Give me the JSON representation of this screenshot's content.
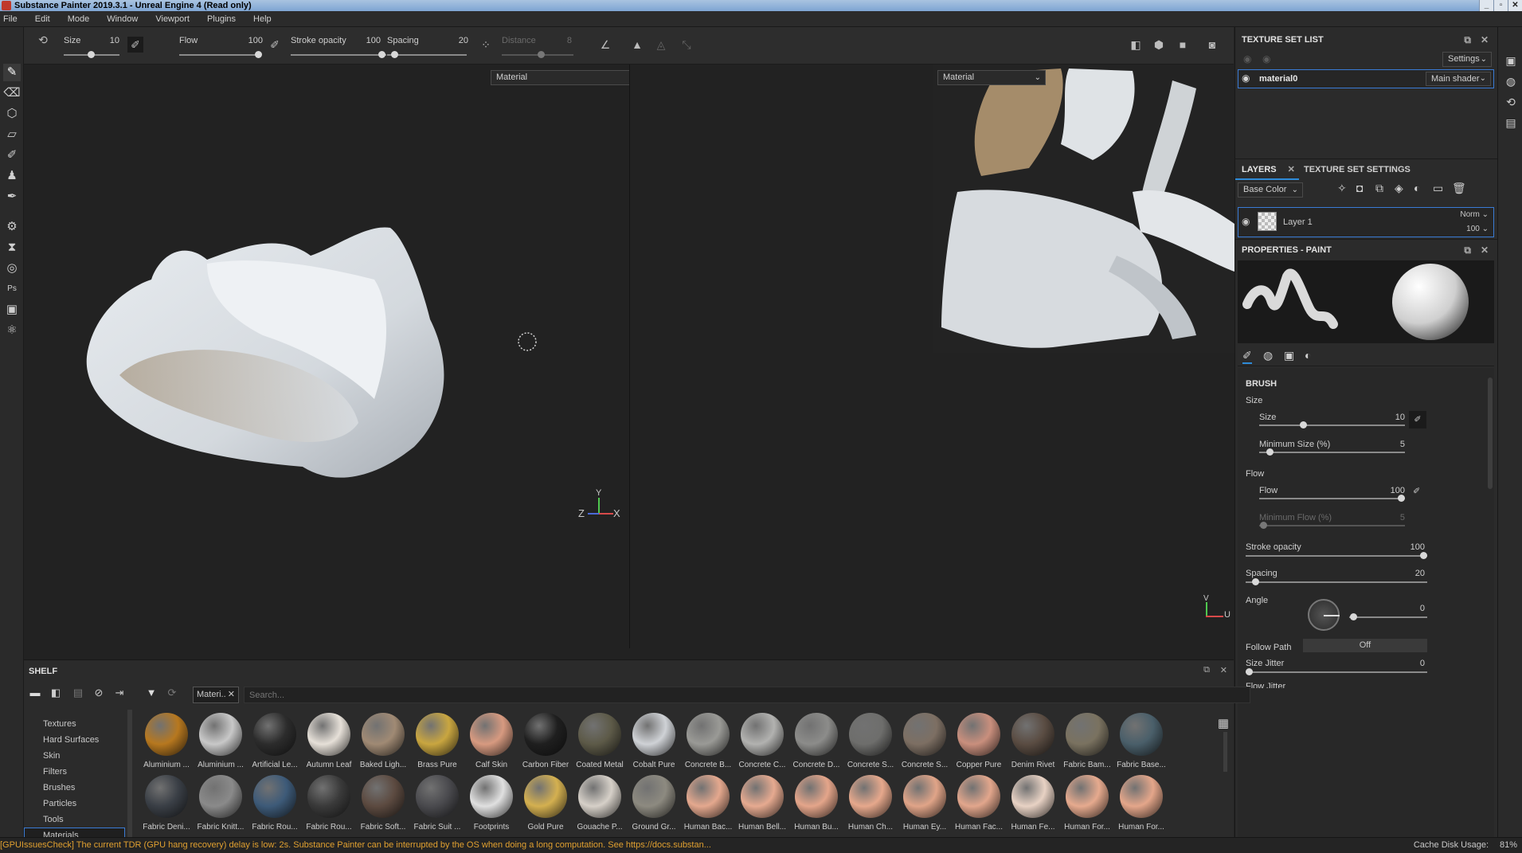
{
  "app": {
    "title": "Substance Painter 2019.3.1 - Unreal Engine 4 (Read only)",
    "window_buttons": [
      "_",
      "▫",
      "✕"
    ]
  },
  "menu": [
    "File",
    "Edit",
    "Mode",
    "Window",
    "Viewport",
    "Plugins",
    "Help"
  ],
  "toolbar": {
    "size_label": "Size",
    "size_value": "10",
    "flow_label": "Flow",
    "flow_value": "100",
    "stroke_opacity_label": "Stroke opacity",
    "stroke_opacity_value": "100",
    "spacing_label": "Spacing",
    "spacing_value": "20",
    "distance_label": "Distance",
    "distance_value": "8"
  },
  "viewport3d": {
    "material_dropdown": "Material",
    "axis": {
      "y": "Y",
      "z": "Z",
      "x": "X"
    }
  },
  "viewport2d": {
    "material_dropdown": "Material",
    "axis": {
      "v": "V",
      "u": "U"
    }
  },
  "texture_set_list": {
    "title": "TEXTURE SET LIST",
    "settings_label": "Settings",
    "item_name": "material0",
    "shader_label": "Main shader"
  },
  "layers_panel": {
    "tab_layers": "LAYERS",
    "tab_texture_set_settings": "TEXTURE SET SETTINGS",
    "channel_dropdown": "Base Color",
    "layer_name": "Layer 1",
    "blend_mode": "Norm",
    "opacity": "100"
  },
  "properties": {
    "title": "PROPERTIES - PAINT",
    "brush_title": "BRUSH",
    "size_group": "Size",
    "size_label": "Size",
    "size_value": "10",
    "size_fraction": 0.3,
    "min_size_label": "Minimum Size (%)",
    "min_size_value": "5",
    "min_size_fraction": 0.05,
    "flow_group": "Flow",
    "flow_label": "Flow",
    "flow_value": "100",
    "flow_fraction": 1.0,
    "min_flow_label": "Minimum Flow (%)",
    "min_flow_value": "5",
    "stroke_opacity_label": "Stroke opacity",
    "stroke_opacity_value": "100",
    "stroke_opacity_fraction": 1.0,
    "spacing_label": "Spacing",
    "spacing_value": "20",
    "spacing_fraction": 0.05,
    "angle_label": "Angle",
    "angle_value": "0",
    "follow_path_label": "Follow Path",
    "follow_path_value": "Off",
    "size_jitter_label": "Size Jitter",
    "size_jitter_value": "0",
    "flow_jitter_label": "Flow Jitter"
  },
  "shelf": {
    "title": "SHELF",
    "filter_tag": "Materi..",
    "search_placeholder": "Search...",
    "categories": [
      "Textures",
      "Hard Surfaces",
      "Skin",
      "Filters",
      "Brushes",
      "Particles",
      "Tools",
      "Materials"
    ],
    "selected_category": "Materials",
    "row1": [
      {
        "name": "Aluminium ...",
        "color": "#b7781f"
      },
      {
        "name": "Aluminium ...",
        "color": "#c8c8c8"
      },
      {
        "name": "Artificial Le...",
        "color": "#2c2c2c"
      },
      {
        "name": "Autumn Leaf",
        "color": "#e6e0d8"
      },
      {
        "name": "Baked Ligh...",
        "color": "#a08a74"
      },
      {
        "name": "Brass Pure",
        "color": "#c9a640"
      },
      {
        "name": "Calf Skin",
        "color": "#d79a80"
      },
      {
        "name": "Carbon Fiber",
        "color": "#1f1f1f"
      },
      {
        "name": "Coated Metal",
        "color": "#5d5a48"
      },
      {
        "name": "Cobalt Pure",
        "color": "#cfd2d6"
      },
      {
        "name": "Concrete B...",
        "color": "#9a9a96"
      },
      {
        "name": "Concrete C...",
        "color": "#b2b2b0"
      },
      {
        "name": "Concrete D...",
        "color": "#8c8c8a"
      },
      {
        "name": "Concrete S...",
        "color": "#6e6e6c"
      },
      {
        "name": "Concrete S...",
        "color": "#7d6f63"
      },
      {
        "name": "Copper Pure",
        "color": "#c98f7d"
      },
      {
        "name": "Denim Rivet",
        "color": "#5a4c42"
      },
      {
        "name": "Fabric Bam...",
        "color": "#7a7260"
      },
      {
        "name": "Fabric Base...",
        "color": "#4a5f6a"
      }
    ],
    "row2": [
      {
        "name": "Fabric Deni...",
        "color": "#3a3f46"
      },
      {
        "name": "Fabric Knitt...",
        "color": "#8a8a8a"
      },
      {
        "name": "Fabric Rou...",
        "color": "#3d5a78"
      },
      {
        "name": "Fabric Rou...",
        "color": "#3a3a3a"
      },
      {
        "name": "Fabric Soft...",
        "color": "#5c4a40"
      },
      {
        "name": "Fabric Suit ...",
        "color": "#4a4a4e"
      },
      {
        "name": "Footprints",
        "color": "#e0e0e0"
      },
      {
        "name": "Gold Pure",
        "color": "#d4b050"
      },
      {
        "name": "Gouache P...",
        "color": "#d6d0c8"
      },
      {
        "name": "Ground Gr...",
        "color": "#8d8a80"
      },
      {
        "name": "Human Bac...",
        "color": "#e4a88e"
      },
      {
        "name": "Human Bell...",
        "color": "#e6aa90"
      },
      {
        "name": "Human Bu...",
        "color": "#e4a58a"
      },
      {
        "name": "Human Ch...",
        "color": "#e6a88c"
      },
      {
        "name": "Human Ey...",
        "color": "#e0a488"
      },
      {
        "name": "Human Fac...",
        "color": "#e2a68c"
      },
      {
        "name": "Human Fe...",
        "color": "#e8d2c4"
      },
      {
        "name": "Human For...",
        "color": "#e6aa8e"
      },
      {
        "name": "Human For...",
        "color": "#e4a68a"
      }
    ]
  },
  "status": {
    "message": "[GPUIssuesCheck] The current TDR (GPU hang recovery) delay is low: 2s. Substance Painter can be interrupted by the OS when doing a long computation. See https://docs.substan...",
    "cache_label": "Cache Disk Usage:",
    "cache_value": "81%"
  },
  "colors": {
    "accent_blue": "#2e8bd8",
    "status_text": "#e0a030",
    "selected_border": "#3a7bd5"
  }
}
